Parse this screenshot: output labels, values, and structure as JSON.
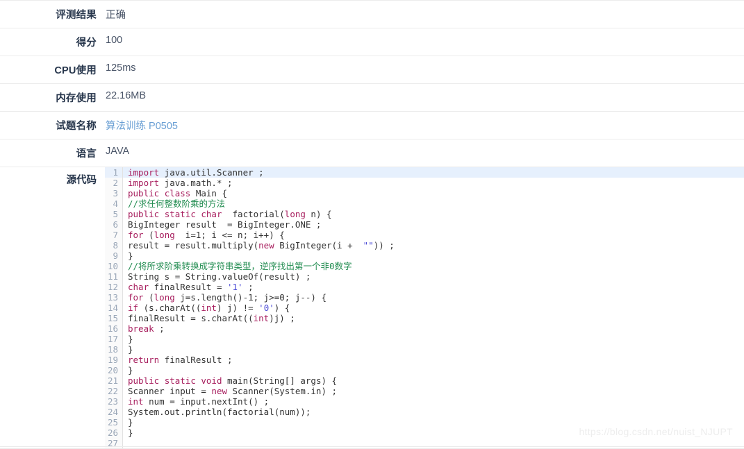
{
  "panel": {
    "rows": [
      {
        "label": "评测结果",
        "value": "正确",
        "is_link": false
      },
      {
        "label": "得分",
        "value": "100",
        "is_link": false
      },
      {
        "label": "CPU使用",
        "value": "125ms",
        "is_link": false
      },
      {
        "label": "内存使用",
        "value": "22.16MB",
        "is_link": false
      },
      {
        "label": "试题名称",
        "value": "算法训练 P0505",
        "is_link": true
      },
      {
        "label": "语言",
        "value": "JAVA",
        "is_link": false
      }
    ],
    "code_label": "源代码"
  },
  "code": {
    "language": "JAVA",
    "active_line": 1,
    "total_lines": 27,
    "lines": [
      {
        "n": 1,
        "tokens": [
          {
            "t": "import",
            "c": "k"
          },
          {
            "t": " java.util.Scanner ;",
            "c": "pl"
          }
        ]
      },
      {
        "n": 2,
        "tokens": [
          {
            "t": "import",
            "c": "k"
          },
          {
            "t": " java.math.* ;",
            "c": "pl"
          }
        ]
      },
      {
        "n": 3,
        "tokens": [
          {
            "t": "public",
            "c": "k"
          },
          {
            "t": " ",
            "c": "pl"
          },
          {
            "t": "class",
            "c": "k"
          },
          {
            "t": " Main {",
            "c": "pl"
          }
        ]
      },
      {
        "n": 4,
        "tokens": [
          {
            "t": "//求任何整数阶乘的方法",
            "c": "cm"
          }
        ]
      },
      {
        "n": 5,
        "tokens": [
          {
            "t": "public",
            "c": "k"
          },
          {
            "t": " ",
            "c": "pl"
          },
          {
            "t": "static",
            "c": "k"
          },
          {
            "t": " ",
            "c": "pl"
          },
          {
            "t": "char",
            "c": "k"
          },
          {
            "t": "  factorial(",
            "c": "pl"
          },
          {
            "t": "long",
            "c": "k"
          },
          {
            "t": " n) {",
            "c": "pl"
          }
        ]
      },
      {
        "n": 6,
        "tokens": [
          {
            "t": "BigInteger result  = BigInteger.ONE ;",
            "c": "pl"
          }
        ]
      },
      {
        "n": 7,
        "tokens": [
          {
            "t": "for",
            "c": "k"
          },
          {
            "t": " (",
            "c": "pl"
          },
          {
            "t": "long",
            "c": "k"
          },
          {
            "t": "  i=1; i <= n; i++) {",
            "c": "pl"
          }
        ]
      },
      {
        "n": 8,
        "tokens": [
          {
            "t": "result = result.multiply(",
            "c": "pl"
          },
          {
            "t": "new",
            "c": "k"
          },
          {
            "t": " BigInteger(i +  ",
            "c": "pl"
          },
          {
            "t": "\"\"",
            "c": "st"
          },
          {
            "t": ")) ;",
            "c": "pl"
          }
        ]
      },
      {
        "n": 9,
        "tokens": [
          {
            "t": "}",
            "c": "pl"
          }
        ]
      },
      {
        "n": 10,
        "tokens": [
          {
            "t": "//将所求阶乘转换成字符串类型，逆序找出第一个非0数字",
            "c": "cm"
          }
        ]
      },
      {
        "n": 11,
        "tokens": [
          {
            "t": "String s = String.valueOf(result) ;",
            "c": "pl"
          }
        ]
      },
      {
        "n": 12,
        "tokens": [
          {
            "t": "char",
            "c": "k"
          },
          {
            "t": " finalResult = ",
            "c": "pl"
          },
          {
            "t": "'1'",
            "c": "st"
          },
          {
            "t": " ;",
            "c": "pl"
          }
        ]
      },
      {
        "n": 13,
        "tokens": [
          {
            "t": "for",
            "c": "k"
          },
          {
            "t": " (",
            "c": "pl"
          },
          {
            "t": "long",
            "c": "k"
          },
          {
            "t": " j=s.length()-1; j>=0; j--) {",
            "c": "pl"
          }
        ]
      },
      {
        "n": 14,
        "tokens": [
          {
            "t": "if",
            "c": "k"
          },
          {
            "t": " (s.charAt((",
            "c": "pl"
          },
          {
            "t": "int",
            "c": "k"
          },
          {
            "t": ") j) != ",
            "c": "pl"
          },
          {
            "t": "'0'",
            "c": "st"
          },
          {
            "t": ") {",
            "c": "pl"
          }
        ]
      },
      {
        "n": 15,
        "tokens": [
          {
            "t": "finalResult = s.charAt((",
            "c": "pl"
          },
          {
            "t": "int",
            "c": "k"
          },
          {
            "t": ")j) ;",
            "c": "pl"
          }
        ]
      },
      {
        "n": 16,
        "tokens": [
          {
            "t": "break",
            "c": "k"
          },
          {
            "t": " ;",
            "c": "pl"
          }
        ]
      },
      {
        "n": 17,
        "tokens": [
          {
            "t": "}",
            "c": "pl"
          }
        ]
      },
      {
        "n": 18,
        "tokens": [
          {
            "t": "}",
            "c": "pl"
          }
        ]
      },
      {
        "n": 19,
        "tokens": [
          {
            "t": "return",
            "c": "k"
          },
          {
            "t": " finalResult ;",
            "c": "pl"
          }
        ]
      },
      {
        "n": 20,
        "tokens": [
          {
            "t": "}",
            "c": "pl"
          }
        ]
      },
      {
        "n": 21,
        "tokens": [
          {
            "t": "public",
            "c": "k"
          },
          {
            "t": " ",
            "c": "pl"
          },
          {
            "t": "static",
            "c": "k"
          },
          {
            "t": " ",
            "c": "pl"
          },
          {
            "t": "void",
            "c": "k"
          },
          {
            "t": " main(String[] args) {",
            "c": "pl"
          }
        ]
      },
      {
        "n": 22,
        "tokens": [
          {
            "t": "Scanner input = ",
            "c": "pl"
          },
          {
            "t": "new",
            "c": "k"
          },
          {
            "t": " Scanner(System.in) ;",
            "c": "pl"
          }
        ]
      },
      {
        "n": 23,
        "tokens": [
          {
            "t": "int",
            "c": "k"
          },
          {
            "t": " num = input.nextInt() ;",
            "c": "pl"
          }
        ]
      },
      {
        "n": 24,
        "tokens": [
          {
            "t": "System.out.println(factorial(num));",
            "c": "pl"
          }
        ]
      },
      {
        "n": 25,
        "tokens": [
          {
            "t": "}",
            "c": "pl"
          }
        ]
      },
      {
        "n": 26,
        "tokens": [
          {
            "t": "}",
            "c": "pl"
          }
        ]
      },
      {
        "n": 27,
        "tokens": [
          {
            "t": "",
            "c": "pl"
          }
        ]
      }
    ]
  },
  "watermark": {
    "text": "https://blog.csdn.net/nuist_NJUPT"
  },
  "colors": {
    "label": "#27364c",
    "value": "#4a5568",
    "link": "#6a9fd4",
    "row_border": "#ececec",
    "active_line_bg": "#e6f0fd",
    "keyword": "#a71d5d",
    "comment": "#218c50",
    "string": "#4b4bd6",
    "line_number": "#9aa7b8",
    "watermark": "#ededed"
  }
}
